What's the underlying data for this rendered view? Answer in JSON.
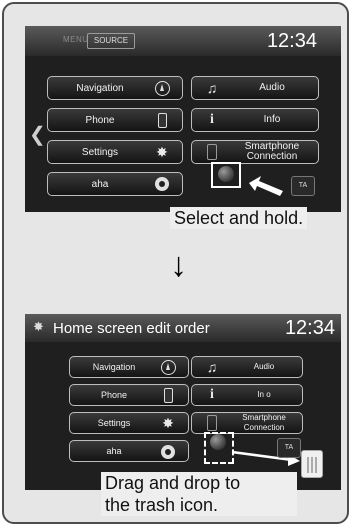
{
  "screen1": {
    "menu_label": "MENU",
    "source_label": "SOURCE",
    "clock": "12:34",
    "left_buttons": [
      {
        "label": "Navigation",
        "icon": "navigation-icon"
      },
      {
        "label": "Phone",
        "icon": "phone-icon"
      },
      {
        "label": "Settings",
        "icon": "gear-icon"
      },
      {
        "label": "aha",
        "icon": "aha-icon"
      }
    ],
    "right_buttons": [
      {
        "label": "Audio",
        "icon": "music-note-icon"
      },
      {
        "label": "Info",
        "icon": "info-icon"
      },
      {
        "label": "Smartphone Connection",
        "icon": "smartphone-icon"
      }
    ],
    "ta_label": "TA",
    "caption": "Select and hold."
  },
  "screen2": {
    "title": "Home screen edit order",
    "clock": "12:34",
    "left_buttons": [
      {
        "label": "Navigation",
        "icon": "navigation-icon"
      },
      {
        "label": "Phone",
        "icon": "phone-icon"
      },
      {
        "label": "Settings",
        "icon": "gear-icon"
      },
      {
        "label": "aha",
        "icon": "aha-icon"
      }
    ],
    "right_buttons": [
      {
        "label": "Audio",
        "icon": "music-note-icon"
      },
      {
        "label": "In o",
        "icon": "info-icon"
      },
      {
        "label": "Smartphone Connection",
        "icon": "smartphone-icon"
      }
    ],
    "ta_label": "TA",
    "caption_line1": "Drag and drop to",
    "caption_line2": "the trash icon."
  }
}
